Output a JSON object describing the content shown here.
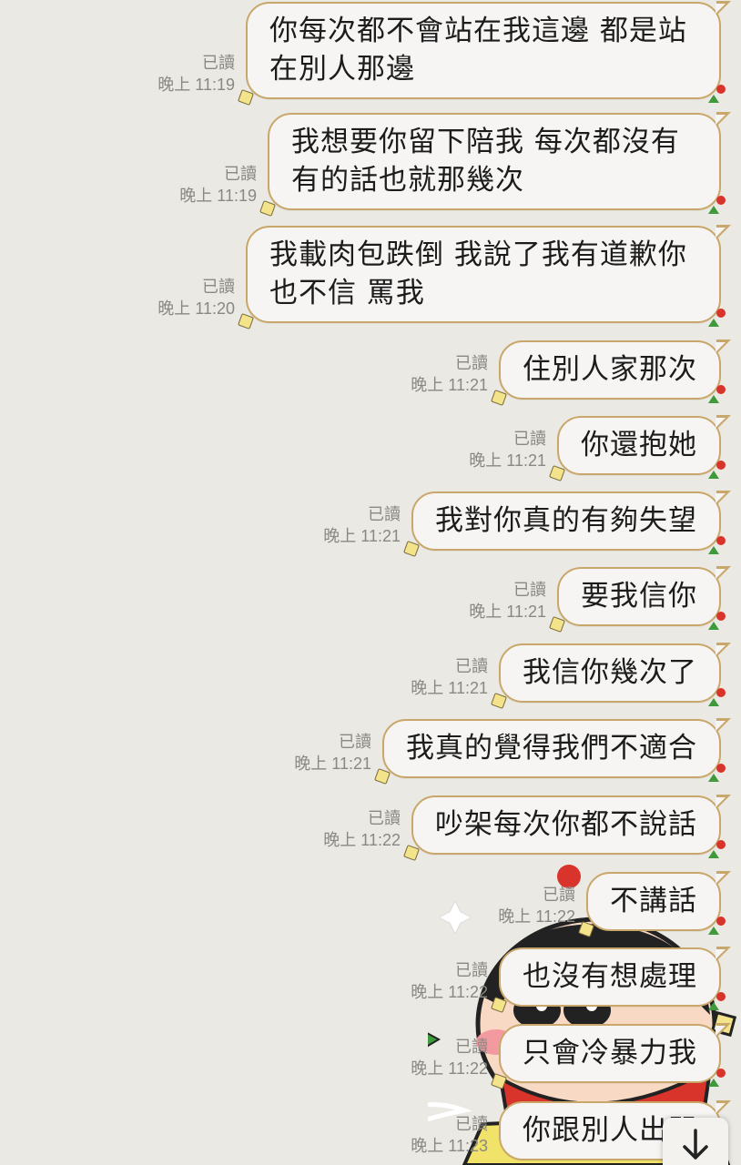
{
  "messages": [
    {
      "read": "已讀",
      "time": "晚上 11:19",
      "text": "你每次都不會站在我這邊 都是站在別人那邊"
    },
    {
      "read": "已讀",
      "time": "晚上 11:19",
      "text": "我想要你留下陪我 每次都沒有有的話也就那幾次"
    },
    {
      "read": "已讀",
      "time": "晚上 11:20",
      "text": "我載肉包跌倒 我說了我有道歉你也不信 罵我"
    },
    {
      "read": "已讀",
      "time": "晚上 11:21",
      "text": "住別人家那次"
    },
    {
      "read": "已讀",
      "time": "晚上 11:21",
      "text": "你還抱她"
    },
    {
      "read": "已讀",
      "time": "晚上 11:21",
      "text": "我對你真的有夠失望"
    },
    {
      "read": "已讀",
      "time": "晚上 11:21",
      "text": "要我信你"
    },
    {
      "read": "已讀",
      "time": "晚上 11:21",
      "text": "我信你幾次了"
    },
    {
      "read": "已讀",
      "time": "晚上 11:21",
      "text": "我真的覺得我們不適合"
    },
    {
      "read": "已讀",
      "time": "晚上 11:22",
      "text": "吵架每次你都不說話"
    },
    {
      "read": "已讀",
      "time": "晚上 11:22",
      "text": "不講話"
    },
    {
      "read": "已讀",
      "time": "晚上 11:22",
      "text": "也沒有想處理"
    },
    {
      "read": "已讀",
      "time": "晚上 11:22",
      "text": "只會冷暴力我"
    },
    {
      "read": "已讀",
      "time": "晚上 11:23",
      "text": "你跟別人出門"
    }
  ],
  "icons": {
    "sticker": "crayon-shin-chan-sticker",
    "scroll": "arrow-down-icon"
  },
  "colors": {
    "background": "#ebe9e4",
    "bubble": "#f6f5f3",
    "bubble_border": "#c9a76a",
    "meta_text": "#8a8883"
  }
}
